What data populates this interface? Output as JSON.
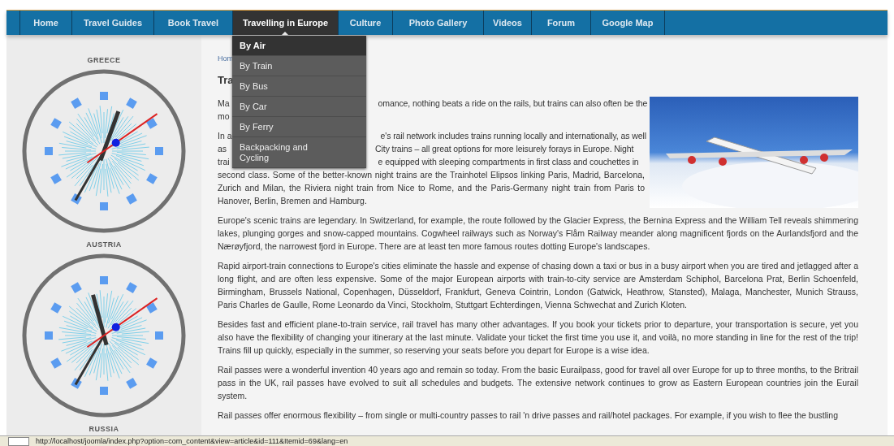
{
  "nav": [
    {
      "label": "Home",
      "selected": false
    },
    {
      "label": "Travel Guides",
      "selected": false
    },
    {
      "label": "Book Travel",
      "selected": false
    },
    {
      "label": "Travelling in Europe",
      "selected": true
    },
    {
      "label": "Culture",
      "selected": false
    },
    {
      "label": "Photo Gallery",
      "selected": false
    },
    {
      "label": "Videos",
      "selected": false
    },
    {
      "label": "Forum",
      "selected": false
    },
    {
      "label": "Google Map",
      "selected": false
    }
  ],
  "dropdown": [
    {
      "label": "By Air",
      "selected": true
    },
    {
      "label": "By Train",
      "selected": false
    },
    {
      "label": "By Bus",
      "selected": false
    },
    {
      "label": "By Car",
      "selected": false
    },
    {
      "label": "By Ferry",
      "selected": false
    },
    {
      "label": "Backpacking and Cycling",
      "selected": false
    }
  ],
  "sidebar": {
    "clocks": [
      {
        "label": "GREECE"
      },
      {
        "label": "AUSTRIA"
      },
      {
        "label": "RUSSIA"
      }
    ]
  },
  "article": {
    "breadcrumb": "Hom",
    "title": "Tra",
    "covered_lines": [
      {
        "left": "Ma",
        "right": "omance, nothing beats a ride on the rails, but trains can also often be the"
      },
      {
        "left": "mo"
      },
      {
        "left": "In a",
        "right": "e's rail network includes trains running locally and internationally, as well"
      },
      {
        "left": "as",
        "right": "City trains – all great options for more leisurely forays in Europe. Night"
      },
      {
        "left": "trai",
        "right": "e equipped with sleeping compartments in first class and couchettes in"
      }
    ],
    "paragraphs": [
      "second class. Some of the better-known night trains are the Trainhotel Elipsos linking Paris, Madrid, Barcelona, Zurich and Milan, the Riviera night train from Nice to Rome, and the Paris-Germany night train from Paris to Hanover, Berlin, Bremen and Hamburg.",
      "Europe's scenic trains are legendary. In Switzerland, for example, the route followed by the Glacier Express, the Bernina Express and the William Tell reveals shimmering lakes, plunging gorges and snow-capped mountains. Cogwheel railways such as Norway's Flåm Railway meander along magnificent fjords on the Aurlandsfjord and the Nærøyfjord, the narrowest fjord in Europe. There are at least ten more famous routes dotting Europe's landscapes.",
      "Rapid airport-train connections to Europe's cities eliminate the hassle and expense of chasing down a taxi or bus in a busy airport when you are tired and jetlagged after a long flight, and are often less expensive. Some of the major European airports with train-to-city service are Amsterdam Schiphol, Barcelona Prat, Berlin Schoenfeld, Birmingham, Brussels National, Copenhagen, Düsseldorf, Frankfurt, Geneva Cointrin, London (Gatwick, Heathrow, Stansted), Malaga, Manchester, Munich Strauss, Paris Charles de Gaulle, Rome Leonardo da Vinci, Stockholm, Stuttgart Echterdingen, Vienna Schwechat and Zurich Kloten.",
      "Besides fast and efficient plane-to-train service, rail travel has many other advantages. If you book your tickets prior to departure, your transportation is secure, yet you also have the flexibility of changing your itinerary at the last minute. Validate your ticket the first time you use it, and voilà, no more standing in line for the rest of the trip! Trains fill up quickly, especially in the summer, so reserving your seats before you depart for Europe is a wise idea.",
      "Rail passes were a wonderful invention 40 years ago and remain so today. From the basic Eurailpass, good for travel all over Europe for up to three months, to the Britrail pass in the UK, rail passes have evolved to suit all schedules and budgets. The extensive network continues to grow as Eastern European countries join the Eurail system.",
      "Rail passes offer enormous flexibility – from single or multi-country passes to rail 'n drive passes and rail/hotel packages. For example, if you wish to flee the bustling"
    ]
  },
  "status_bar": {
    "url": "http://localhost/joomla/index.php?option=com_content&view=article&id=111&Itemid=69&lang=en"
  }
}
